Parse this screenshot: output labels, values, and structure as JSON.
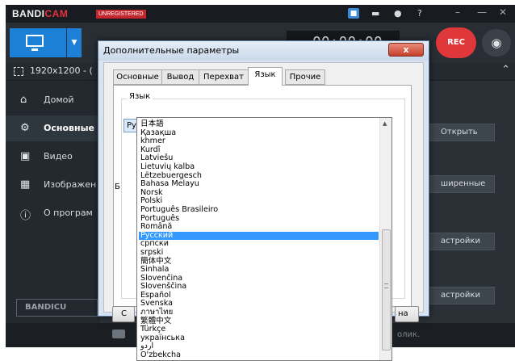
{
  "app": {
    "brand": "BANDICAM",
    "brand_part1": "BANDI",
    "brand_part2": "CAM",
    "unregistered_badge": "UNREGISTERED",
    "timer": "00:00:00",
    "rec_label": "REC",
    "resolution": "1920x1200 - (",
    "sidebar": [
      {
        "icon": "home-icon",
        "label": "Домой"
      },
      {
        "icon": "gear-icon",
        "label": "Основные"
      },
      {
        "icon": "video-icon",
        "label": "Видео"
      },
      {
        "icon": "image-icon",
        "label": "Изображен"
      },
      {
        "icon": "info-icon",
        "label": "О програм"
      }
    ],
    "sidebar_logo": "BANDICU",
    "right_buttons": [
      "Открыть",
      "ширенные",
      "астройки",
      "астройки"
    ],
    "status_text": "олик."
  },
  "dialog": {
    "title": "Дополнительные параметры",
    "close_label": "x",
    "tabs": [
      "Основные",
      "Вывод",
      "Перехват",
      "Язык",
      "Прочие"
    ],
    "selected_tab": "Язык",
    "group_title": "Язык",
    "selected_language": "Русский",
    "partial_label": "Б",
    "button_left_fragment": "С",
    "button_right_fragment": "на"
  },
  "dropdown": {
    "highlighted": "Русский",
    "items": [
      "日本語",
      "Қазақша",
      "khmer",
      "Kurdî",
      "Latviešu",
      "Lietuvių kalba",
      "Lëtzebuergesch",
      "Bahasa Melayu",
      "Norsk",
      "Polski",
      "Português Brasileiro",
      "Português",
      "Română",
      "Русский",
      "српски",
      "srpski",
      "簡体中文",
      "Sinhala",
      "Slovenčina",
      "Slovenščina",
      "Español",
      "Svenska",
      "ภาษาไทย",
      "繁體中文",
      "Türkçe",
      "українська",
      "اردو",
      "O'zbekcha"
    ]
  }
}
